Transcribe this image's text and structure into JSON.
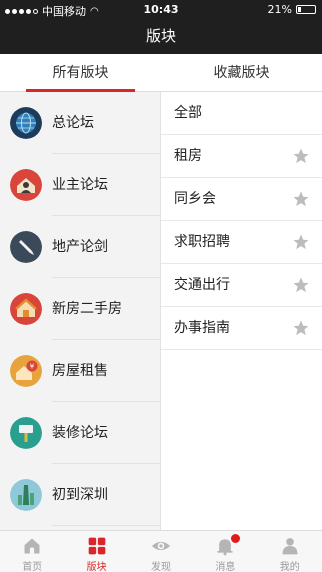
{
  "status_bar": {
    "carrier": "中国移动",
    "time": "10:43",
    "battery": "21%",
    "battery_level": 0.21
  },
  "nav": {
    "title": "版块"
  },
  "tabs": [
    {
      "label": "所有版块",
      "active": true
    },
    {
      "label": "收藏版块",
      "active": false
    }
  ],
  "categories": [
    {
      "label": "总论坛",
      "icon": "globe-icon",
      "color": "#1d3c5c"
    },
    {
      "label": "业主论坛",
      "icon": "owner-house-icon",
      "color": "#d9443b"
    },
    {
      "label": "地产论剑",
      "icon": "pen-icon",
      "color": "#3b4a5b"
    },
    {
      "label": "新房二手房",
      "icon": "house-icon",
      "color": "#d9443b"
    },
    {
      "label": "房屋租售",
      "icon": "rent-house-icon",
      "color": "#e8a43c"
    },
    {
      "label": "装修论坛",
      "icon": "paint-brush-icon",
      "color": "#2a9f8f"
    },
    {
      "label": "初到深圳",
      "icon": "city-tower-icon",
      "color": "#8fc8d8"
    }
  ],
  "subforums": [
    {
      "label": "全部",
      "starred": null
    },
    {
      "label": "租房",
      "starred": false
    },
    {
      "label": "同乡会",
      "starred": false
    },
    {
      "label": "求职招聘",
      "starred": false
    },
    {
      "label": "交通出行",
      "starred": false
    },
    {
      "label": "办事指南",
      "starred": false
    }
  ],
  "tab_bar": [
    {
      "label": "首页",
      "icon": "home-icon",
      "active": false
    },
    {
      "label": "版块",
      "icon": "grid-icon",
      "active": true
    },
    {
      "label": "发现",
      "icon": "eye-icon",
      "active": false
    },
    {
      "label": "消息",
      "icon": "bell-icon",
      "active": false,
      "badge": true
    },
    {
      "label": "我的",
      "icon": "profile-icon",
      "active": false
    }
  ],
  "colors": {
    "accent": "#d8262a",
    "bar": "#1f1f1f",
    "star": "#bcbcbc"
  }
}
